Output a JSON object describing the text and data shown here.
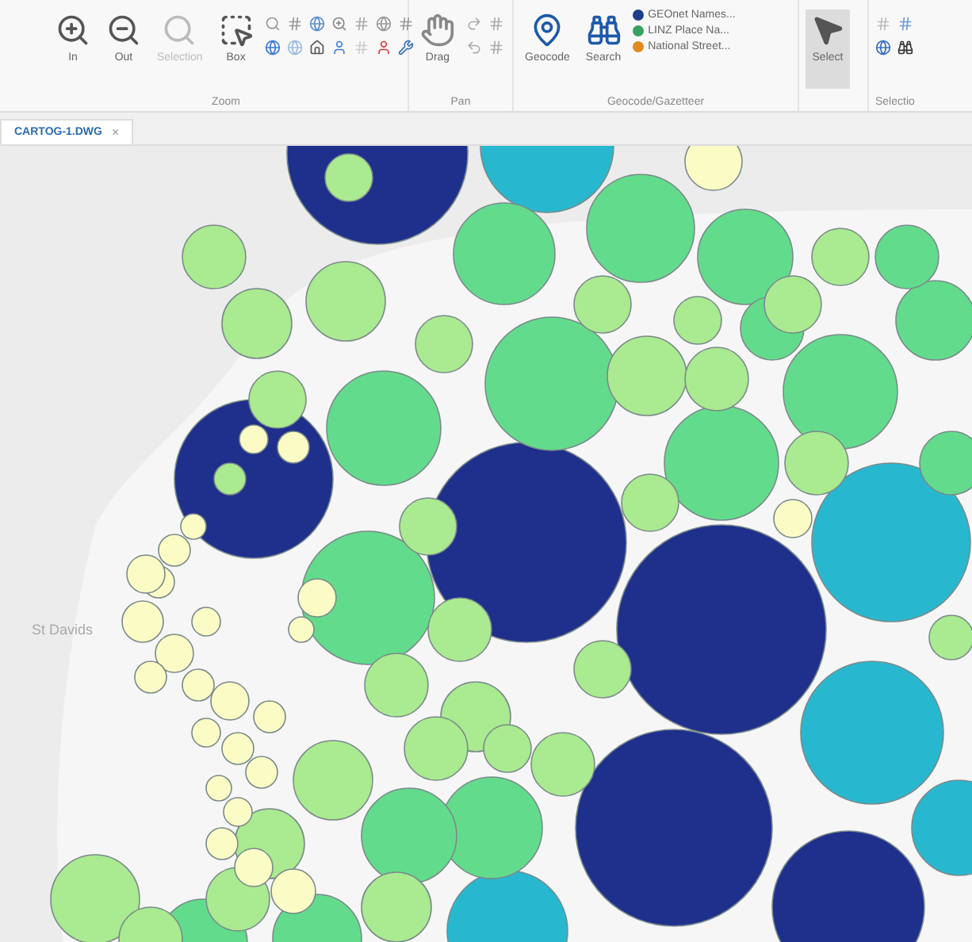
{
  "ribbon": {
    "zoom": {
      "label": "Zoom",
      "buttons": [
        {
          "label": "In",
          "disabled": false
        },
        {
          "label": "Out",
          "disabled": false
        },
        {
          "label": "Selection",
          "disabled": true
        },
        {
          "label": "Box",
          "disabled": false
        }
      ]
    },
    "pan": {
      "label": "Pan",
      "buttons": [
        {
          "label": "Drag",
          "disabled": false
        }
      ]
    },
    "geocode": {
      "label": "Geocode/Gazetteer",
      "buttons": [
        {
          "label": "Geocode"
        },
        {
          "label": "Search"
        }
      ],
      "sources": [
        {
          "label": "GEOnet Names..."
        },
        {
          "label": "LINZ Place Na..."
        },
        {
          "label": "National Street..."
        }
      ]
    },
    "select": {
      "label": "Select",
      "selected": true
    },
    "selection": {
      "label": "Selectio"
    }
  },
  "document_tab": {
    "label": "CARTOG-1.DWG",
    "close": "×"
  },
  "map": {
    "place_labels": [
      "St Davids"
    ]
  }
}
